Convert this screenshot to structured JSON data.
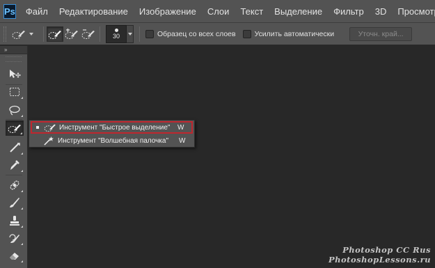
{
  "app": {
    "logo": "Ps"
  },
  "menu": [
    "Файл",
    "Редактирование",
    "Изображение",
    "Слои",
    "Текст",
    "Выделение",
    "Фильтр",
    "3D",
    "Просмотр"
  ],
  "options": {
    "brush_size": "30",
    "sample_all_layers_label": "Образец со всех слоев",
    "sample_all_layers_checked": false,
    "auto_enhance_label": "Усилить автоматически",
    "auto_enhance_checked": false,
    "refine_edge_label": "Уточн. край..."
  },
  "toolbar": {
    "collapse_glyph": "»",
    "tools": [
      {
        "name": "move-tool",
        "icon": "move-icon"
      },
      {
        "name": "marquee-tool",
        "icon": "rect-marquee-icon"
      },
      {
        "name": "lasso-tool",
        "icon": "lasso-icon"
      },
      {
        "name": "quick-selection-tool",
        "icon": "quick-selection-icon",
        "active": true
      },
      {
        "name": "crop-tool",
        "icon": "crop-icon"
      },
      {
        "name": "eyedropper-tool",
        "icon": "eyedropper-icon"
      },
      {
        "name": "healing-brush-tool",
        "icon": "bandage-icon"
      },
      {
        "name": "brush-tool",
        "icon": "brush-icon"
      },
      {
        "name": "clone-stamp-tool",
        "icon": "stamp-icon"
      },
      {
        "name": "history-brush-tool",
        "icon": "history-brush-icon"
      },
      {
        "name": "eraser-tool",
        "icon": "eraser-icon"
      }
    ]
  },
  "flyout": {
    "items": [
      {
        "label": "Инструмент \"Быстрое выделение\"",
        "shortcut": "W",
        "selected": true,
        "icon": "quick-selection-icon"
      },
      {
        "label": "Инструмент \"Волшебная палочка\"",
        "shortcut": "W",
        "selected": false,
        "icon": "magic-wand-icon"
      }
    ],
    "highlight_color": "#c0262e"
  },
  "watermark": {
    "line1": "Photoshop CC Rus",
    "line2": "PhotoshopLessons.ru"
  },
  "colors": {
    "chrome": "#535353",
    "workspace": "#282828",
    "text": "#e2e2e2"
  }
}
